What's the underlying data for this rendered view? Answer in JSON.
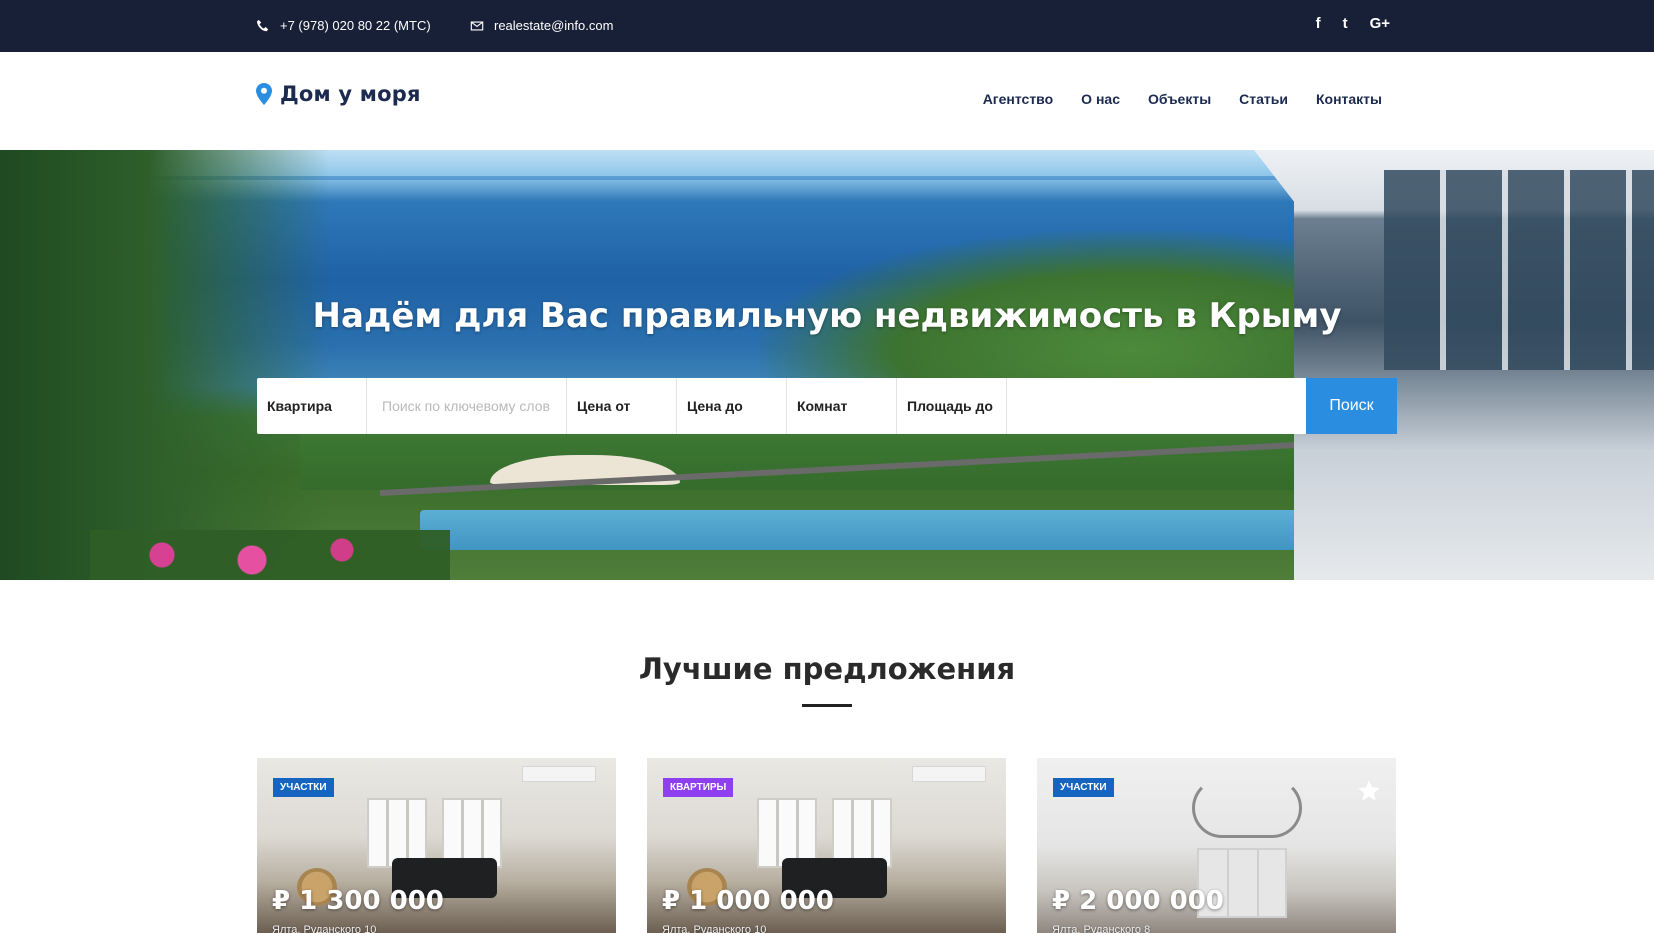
{
  "topbar": {
    "phone": "+7 (978) 020 80 22 (МТС)",
    "email": "realestate@info.com",
    "social": [
      "f",
      "t",
      "G+"
    ]
  },
  "header": {
    "logo": "Дом у моря",
    "nav": [
      "Агентство",
      "О нас",
      "Объекты",
      "Статьи",
      "Контакты"
    ]
  },
  "hero": {
    "title": "Надём для Вас правильную недвижимость в Крыму",
    "search": {
      "type_label": "Квартира",
      "keyword_placeholder": "Поиск по ключевому слов",
      "price_from": "Цена от",
      "price_to": "Цена до",
      "rooms": "Комнат",
      "area_to": "Площадь до",
      "button": "Поиск"
    }
  },
  "section": {
    "title": "Лучшие предложения"
  },
  "cards": [
    {
      "badge": "УЧАСТКИ",
      "badge_color": "#1565c0",
      "price": "₽ 1 300 000",
      "address": "Ялта, Руданского 10"
    },
    {
      "badge": "КВАРТИРЫ",
      "badge_color": "#8e3ff0",
      "price": "₽ 1 000 000",
      "address": "Ялта, Руданского 10"
    },
    {
      "badge": "УЧАСТКИ",
      "badge_color": "#1565c0",
      "price": "₽ 2 000 000",
      "address": "Ялта, Руданского 8",
      "favorite_icon": "star-icon"
    }
  ],
  "colors": {
    "topbar_bg": "#172036",
    "accent": "#2b8de0",
    "logo_pin": "#2b8de0"
  }
}
